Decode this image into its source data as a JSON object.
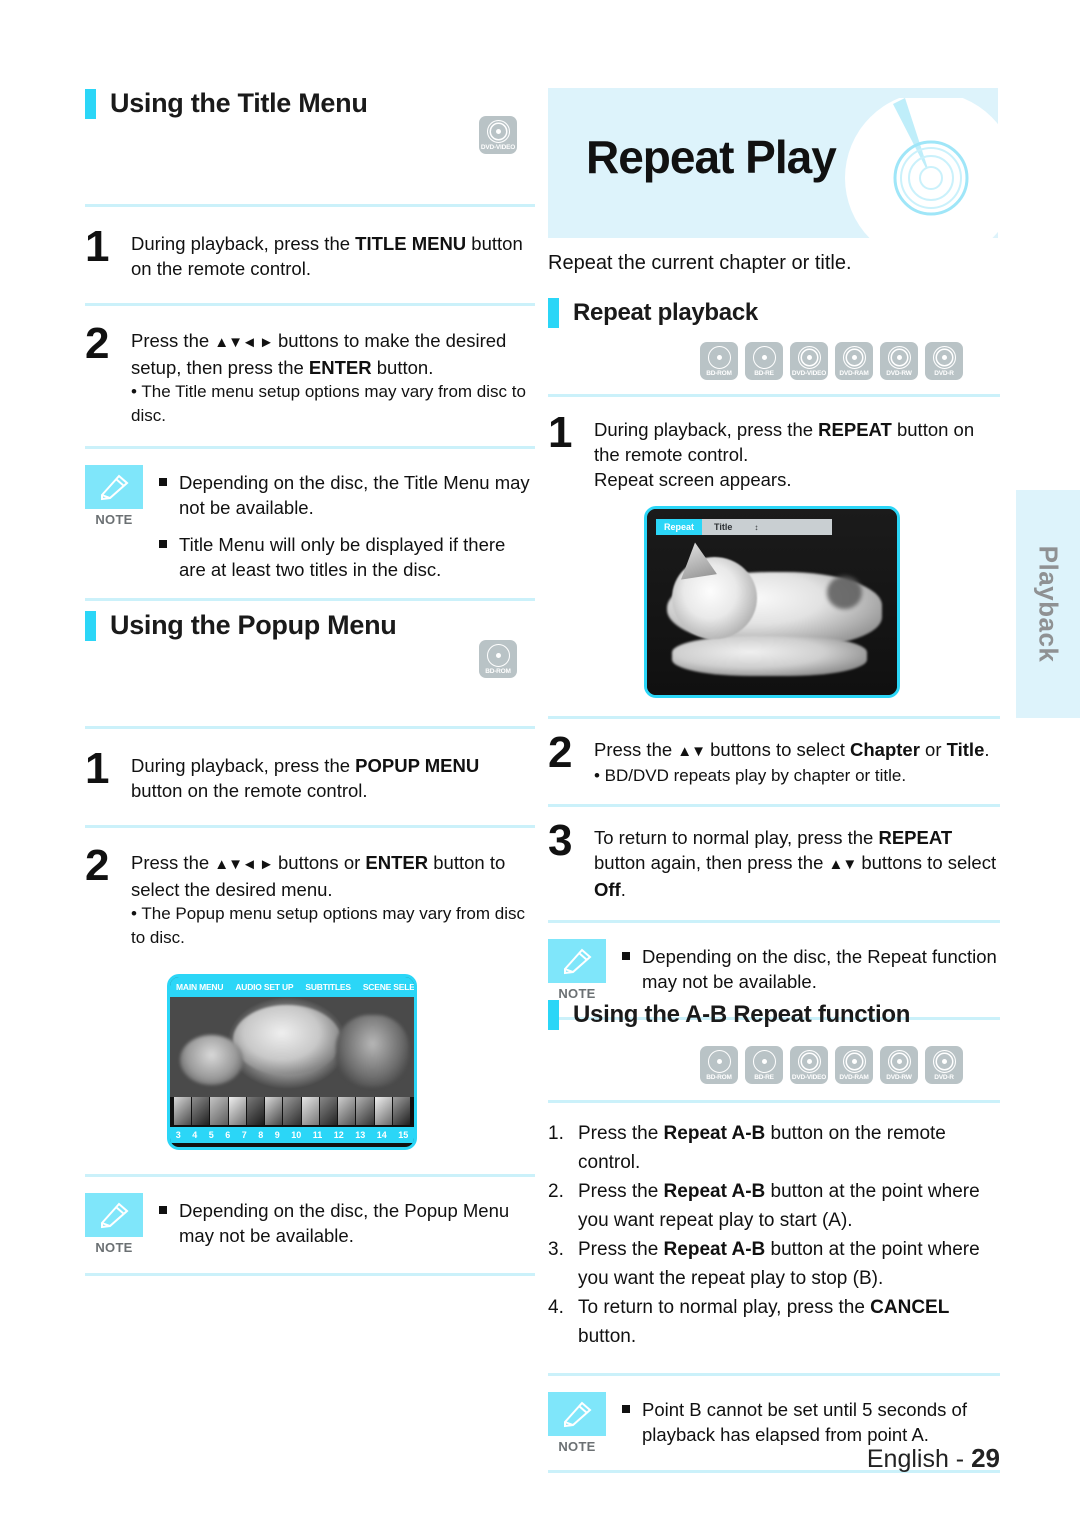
{
  "page": {
    "footer_label": "English -",
    "footer_number": "29",
    "side_tab": "Playback"
  },
  "left_column": {
    "section1": {
      "title": "Using the Title Menu",
      "disc_badge": "DVD-VIDEO",
      "steps": [
        {
          "num": "1",
          "text_before": "During playback, press the ",
          "bold": "TITLE MENU",
          "text_after": " button on the remote control."
        },
        {
          "num": "2",
          "text_before": "Press the ",
          "arrows": "▲▼◄ ►",
          "text_mid": " buttons to make the desired setup, then press the ",
          "bold": "ENTER",
          "text_after": " button.",
          "bullet": "• The Title menu setup options may vary from disc to disc."
        }
      ],
      "note": {
        "label": "NOTE",
        "items": [
          "Depending on the disc, the Title Menu may not be available.",
          "Title Menu will only be displayed if there are at least two titles in the disc."
        ]
      }
    },
    "section2": {
      "title": "Using the Popup Menu",
      "disc_badge": "BD-ROM",
      "steps": [
        {
          "num": "1",
          "text_before": "During playback, press the ",
          "bold": "POPUP MENU",
          "text_after": " button on the remote control."
        },
        {
          "num": "2",
          "text_before": "Press the ",
          "arrows": "▲▼◄ ►",
          "text_mid": " buttons or ",
          "bold": "ENTER",
          "text_after": " button to select the desired menu.",
          "bullet": "• The Popup menu setup options may vary from disc to disc."
        }
      ],
      "screenshot": {
        "menu_items": [
          "MAIN MENU",
          "AUDIO SET UP",
          "SUBTITLES",
          "SCENE SELECTIONS"
        ],
        "scene_numbers": [
          "3",
          "4",
          "5",
          "6",
          "7",
          "8",
          "9",
          "10",
          "11",
          "12",
          "13",
          "14",
          "15"
        ]
      },
      "note": {
        "label": "NOTE",
        "items": [
          "Depending on the disc, the Popup Menu may not be available."
        ]
      }
    }
  },
  "right_column": {
    "banner_title": "Repeat Play",
    "intro": "Repeat the current chapter or title.",
    "section1": {
      "title": "Repeat playback",
      "disc_badges": [
        "BD-ROM",
        "BD-RE",
        "DVD-VIDEO",
        "DVD-RAM",
        "DVD-RW",
        "DVD-R"
      ],
      "steps": [
        {
          "num": "1",
          "text_before": "During playback, press the ",
          "bold": "REPEAT",
          "text_after": " button on the remote control.",
          "extra": "Repeat screen appears."
        },
        {
          "num": "2",
          "text_before": "Press the ",
          "arrows": "▲▼",
          "text_mid": " buttons to select ",
          "bold": "Chapter",
          "text_or": " or ",
          "bold2": "Title",
          "text_after": ".",
          "bullet": "• BD/DVD repeats play by chapter or title."
        },
        {
          "num": "3",
          "text_before": "To return to normal play, press the ",
          "bold": "REPEAT",
          "text_mid": " button again, then press the ",
          "arrows": "▲▼",
          "text_after2": " buttons to select ",
          "bold2": "Off",
          "text_after": "."
        }
      ],
      "screenshot": {
        "osd_key": "Repeat",
        "osd_value": "Title",
        "osd_arrows": "↕"
      },
      "note": {
        "label": "NOTE",
        "items": [
          "Depending on the disc, the Repeat function may not be available."
        ]
      }
    },
    "section2": {
      "title": "Using the A-B Repeat function",
      "disc_badges": [
        "BD-ROM",
        "BD-RE",
        "DVD-VIDEO",
        "DVD-RAM",
        "DVD-RW",
        "DVD-R"
      ],
      "list": [
        {
          "marker": "1.",
          "text_before": "Press the ",
          "bold": "Repeat A-B",
          "text_after": " button on the remote control."
        },
        {
          "marker": "2.",
          "text_before": "Press the ",
          "bold": "Repeat A-B",
          "text_after": " button at the point where you want repeat play to start (A)."
        },
        {
          "marker": "3.",
          "text_before": "Press the ",
          "bold": "Repeat A-B",
          "text_after": " button at the point where you want the repeat play to stop (B)."
        },
        {
          "marker": "4.",
          "text_before": "To return to normal play, press the ",
          "bold": "CANCEL",
          "text_after": " button."
        }
      ],
      "note": {
        "label": "NOTE",
        "items": [
          "Point B cannot be set until 5 seconds of playback has elapsed from point A."
        ]
      }
    }
  },
  "colors": {
    "accent": "#2BD6F7",
    "banner_bg": "#DDF3FB",
    "rule": "#CBF1FA",
    "note_badge": "#7FE6FA",
    "badge_gray": "#B9C3C6"
  }
}
